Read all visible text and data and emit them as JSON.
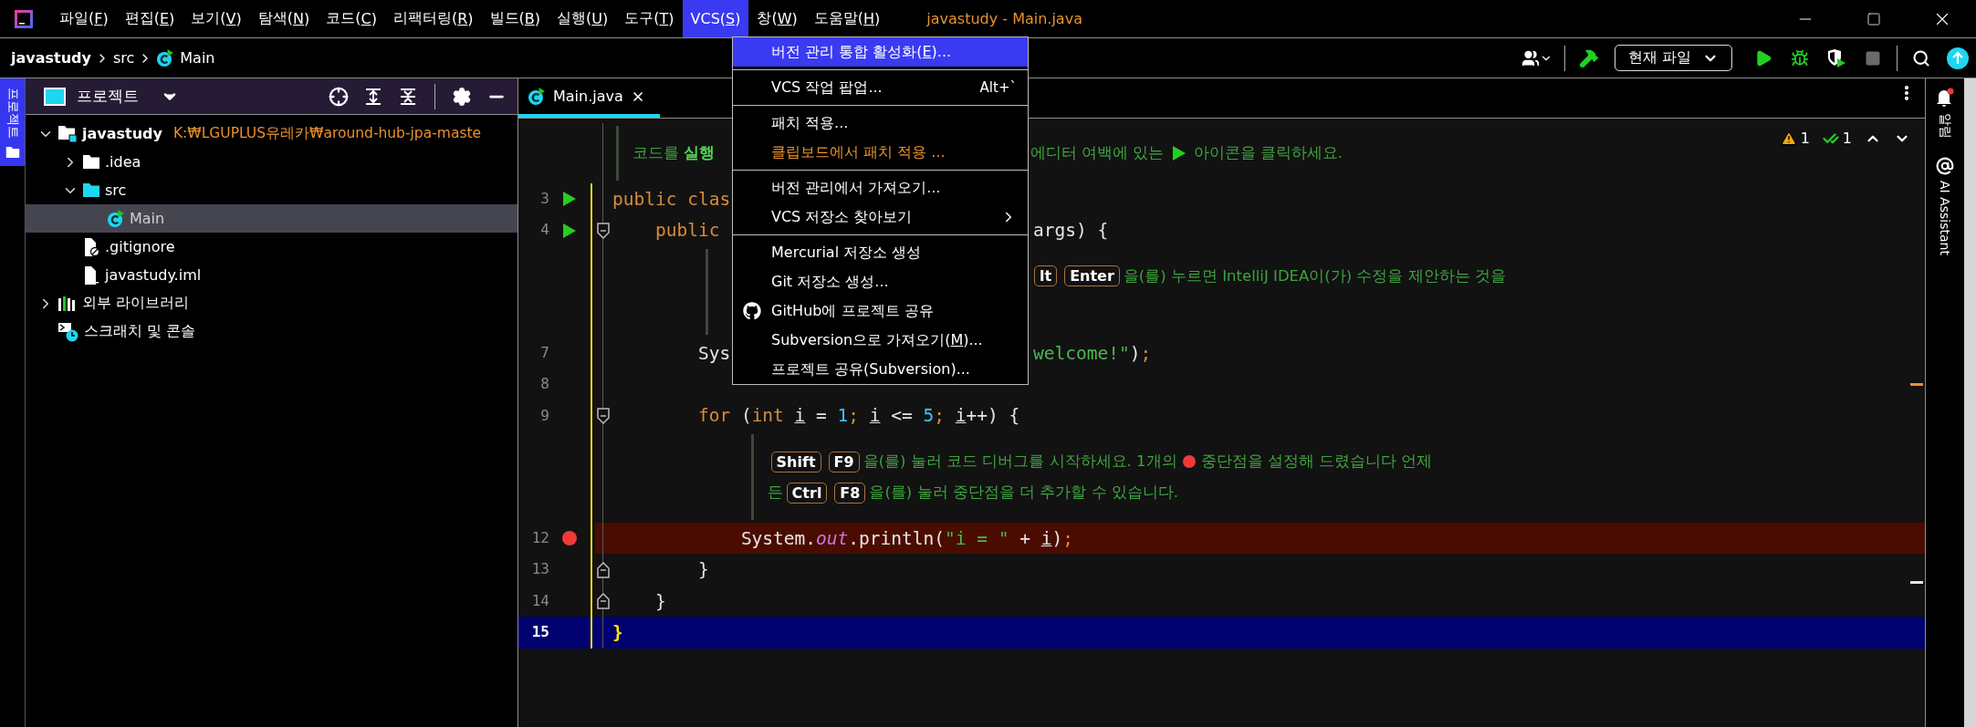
{
  "title_bar": {
    "menus": [
      {
        "label": "파일(F)",
        "selected": false
      },
      {
        "label": "편집(E)",
        "selected": false
      },
      {
        "label": "보기(V)",
        "selected": false
      },
      {
        "label": "탐색(N)",
        "selected": false
      },
      {
        "label": "코드(C)",
        "selected": false
      },
      {
        "label": "리팩터링(R)",
        "selected": false
      },
      {
        "label": "빌드(B)",
        "selected": false
      },
      {
        "label": "실행(U)",
        "selected": false
      },
      {
        "label": "도구(T)",
        "selected": false
      },
      {
        "label": "VCS(S)",
        "selected": true
      },
      {
        "label": "창(W)",
        "selected": false
      },
      {
        "label": "도움말(H)",
        "selected": false
      }
    ],
    "title": "javastudy - Main.java"
  },
  "nav_bar": {
    "breadcrumbs": [
      {
        "label": "javastudy",
        "kind": "project"
      },
      {
        "label": "src",
        "kind": "folder"
      },
      {
        "label": "Main",
        "kind": "class"
      }
    ],
    "run_config": "현재 파일",
    "stop_disabled": true
  },
  "left_stripe": {
    "tabs": [
      {
        "label": "프로젝트",
        "selected": true
      }
    ]
  },
  "project_panel": {
    "title": "프로젝트",
    "tree": [
      {
        "label": "javastudy",
        "path": "K:₩LGUPLUS유레카₩around-hub-jpa-maste",
        "kind": "project",
        "expanded": true,
        "selected": false,
        "children": [
          {
            "label": ".idea",
            "kind": "folder",
            "expanded": false,
            "selected": false
          },
          {
            "label": "src",
            "kind": "source-folder",
            "expanded": true,
            "selected": false,
            "children": [
              {
                "label": "Main",
                "kind": "class",
                "selected": true
              }
            ]
          },
          {
            "label": ".gitignore",
            "kind": "ignore-file",
            "selected": false
          },
          {
            "label": "javastudy.iml",
            "kind": "module-file",
            "selected": false
          }
        ]
      },
      {
        "label": "외부 라이브러리",
        "kind": "libraries",
        "expanded": false,
        "selected": false
      },
      {
        "label": "스크래치 및 콘솔",
        "kind": "scratches",
        "selected": false
      }
    ]
  },
  "editor": {
    "tabs": [
      {
        "label": "Main.java",
        "selected": true
      }
    ],
    "inspections": {
      "warnings": "1",
      "weak_warnings": "1"
    },
    "lines": [
      {
        "kind": "inlay",
        "changed": false,
        "continues": false,
        "lines": [
          {
            "segments": [
              {
                "kind": "text",
                "text": "코드를 **실행**"
              }
            ],
            "after": [
              {
                "kind": "text",
                "text": "에디터 여백에 있는"
              },
              {
                "kind": "run-icon"
              },
              {
                "kind": "text",
                "text": "아이콘을 클릭하세요."
              }
            ]
          }
        ]
      },
      {
        "kind": "code",
        "number": "3",
        "run": true,
        "breakpoint": false,
        "fold_start": false,
        "fold_end": false,
        "current": false,
        "changed": true,
        "tokens": [
          {
            "kind": "keyword",
            "text": "public clas"
          }
        ]
      },
      {
        "kind": "code",
        "number": "4",
        "run": true,
        "breakpoint": false,
        "fold_start": true,
        "fold_end": false,
        "current": false,
        "changed": true,
        "tokens": [
          {
            "kind": "keyword",
            "text": "    public"
          }
        ],
        "after": [
          {
            "kind": "plain",
            "text": "args) {"
          }
        ]
      },
      {
        "kind": "inlay",
        "changed": true,
        "continues": true,
        "lines": [
          {
            "after": [
              {
                "kind": "key",
                "text": "lt"
              },
              {
                "kind": "key",
                "text": "Enter"
              },
              {
                "kind": "text",
                "text": "을(를) 누르면 IntelliJ IDEA이(가) 수정을 제안하는 것을"
              }
            ]
          }
        ]
      },
      {
        "kind": "code",
        "number": "7",
        "run": false,
        "breakpoint": false,
        "fold_start": false,
        "fold_end": false,
        "current": false,
        "changed": true,
        "tokens": [
          {
            "kind": "plain",
            "text": "        Sys"
          }
        ],
        "after": [
          {
            "kind": "string",
            "text": "welcome!\""
          },
          {
            "kind": "plain",
            "text": ")"
          },
          {
            "kind": "punct",
            "text": ";"
          }
        ]
      },
      {
        "kind": "code",
        "number": "8",
        "run": false,
        "breakpoint": false,
        "fold_start": false,
        "fold_end": false,
        "current": false,
        "changed": true
      },
      {
        "kind": "code",
        "number": "9",
        "run": false,
        "breakpoint": false,
        "fold_start": true,
        "fold_end": false,
        "current": false,
        "changed": true,
        "tokens": [
          {
            "kind": "keyword",
            "text": "        for"
          },
          {
            "kind": "plain",
            "text": " ("
          },
          {
            "kind": "keyword",
            "text": "int "
          },
          {
            "kind": "var",
            "text": "i"
          },
          {
            "kind": "plain",
            "text": " = "
          },
          {
            "kind": "number",
            "text": "1"
          },
          {
            "kind": "punct",
            "text": "; "
          },
          {
            "kind": "var",
            "text": "i"
          },
          {
            "kind": "plain",
            "text": " <= "
          },
          {
            "kind": "number",
            "text": "5"
          },
          {
            "kind": "punct",
            "text": "; "
          },
          {
            "kind": "var",
            "text": "i"
          },
          {
            "kind": "plain",
            "text": "++) {"
          }
        ]
      },
      {
        "kind": "inlay",
        "changed": true,
        "continues": false,
        "lines": [
          {
            "segments": [
              {
                "kind": "key",
                "text": "Shift"
              },
              {
                "kind": "key",
                "text": "F9"
              },
              {
                "kind": "text",
                "text": "을(를) 눌러 코드 디버그를 시작하세요. 1개의"
              },
              {
                "kind": "breakpoint-icon"
              },
              {
                "kind": "text",
                "text": "중단점을 설정해 드렸습니다 언제"
              }
            ]
          },
          {
            "segments": [
              {
                "kind": "text",
                "text": "든"
              },
              {
                "kind": "key",
                "text": "Ctrl"
              },
              {
                "kind": "key",
                "text": "F8"
              },
              {
                "kind": "text",
                "text": "을(를) 눌러 중단점을 더 추가할 수 있습니다."
              }
            ]
          }
        ]
      },
      {
        "kind": "code",
        "number": "12",
        "run": false,
        "breakpoint": true,
        "fold_start": false,
        "fold_end": false,
        "current": false,
        "changed": true,
        "tokens": [
          {
            "kind": "plain",
            "text": "            System."
          },
          {
            "kind": "field",
            "text": "out"
          },
          {
            "kind": "plain",
            "text": ".println("
          },
          {
            "kind": "string",
            "text": "\"i = \""
          },
          {
            "kind": "plain",
            "text": " + "
          },
          {
            "kind": "var",
            "text": "i"
          },
          {
            "kind": "plain",
            "text": ")"
          },
          {
            "kind": "punct",
            "text": ";"
          }
        ]
      },
      {
        "kind": "code",
        "number": "13",
        "run": false,
        "breakpoint": false,
        "fold_start": false,
        "fold_end": true,
        "current": false,
        "changed": true,
        "tokens": [
          {
            "kind": "plain",
            "text": "        }"
          }
        ]
      },
      {
        "kind": "code",
        "number": "14",
        "run": false,
        "breakpoint": false,
        "fold_start": false,
        "fold_end": true,
        "current": false,
        "changed": true,
        "tokens": [
          {
            "kind": "plain",
            "text": "    }"
          }
        ]
      },
      {
        "kind": "code",
        "number": "15",
        "run": false,
        "breakpoint": false,
        "fold_start": false,
        "fold_end": false,
        "current": true,
        "changed": true,
        "tokens": [
          {
            "kind": "brace-match",
            "text": "}"
          }
        ]
      }
    ]
  },
  "right_stripe": {
    "tabs": [
      {
        "label": "알림",
        "kind": "notifications"
      },
      {
        "label": "AI Assistant",
        "kind": "assistant"
      }
    ]
  },
  "vcs_menu": {
    "groups": [
      {
        "items": [
          {
            "label": "버전 관리 통합 활성화(E)...",
            "selected": true,
            "color": "#ffffff"
          }
        ]
      },
      {
        "items": [
          {
            "label": "VCS 작업 팝업...",
            "shortcut": "Alt+`",
            "selected": false,
            "color": "#ffffff"
          }
        ]
      },
      {
        "items": [
          {
            "label": "패치 적용...",
            "selected": false,
            "color": "#ffffff"
          },
          {
            "label": "클립보드에서 패치 적용 ...",
            "selected": false,
            "color": "#e8912d"
          }
        ]
      },
      {
        "items": [
          {
            "label": "버전 관리에서 가져오기...",
            "selected": false,
            "color": "#ffffff"
          },
          {
            "label": "VCS 저장소 찾아보기",
            "submenu": true,
            "selected": false,
            "color": "#ffffff"
          }
        ]
      },
      {
        "items": [
          {
            "label": "Mercurial 저장소 생성",
            "selected": false,
            "color": "#ffffff"
          },
          {
            "label": "Git 저장소 생성...",
            "selected": false,
            "color": "#ffffff"
          },
          {
            "label": "GitHub에 프로젝트 공유",
            "icon": true,
            "selected": false,
            "color": "#ffffff"
          },
          {
            "label": "Subversion으로 가져오기(M)...",
            "selected": false,
            "color": "#ffffff"
          },
          {
            "label": "프로젝트 공유(Subversion)...",
            "selected": false,
            "color": "#ffffff"
          }
        ]
      }
    ]
  }
}
